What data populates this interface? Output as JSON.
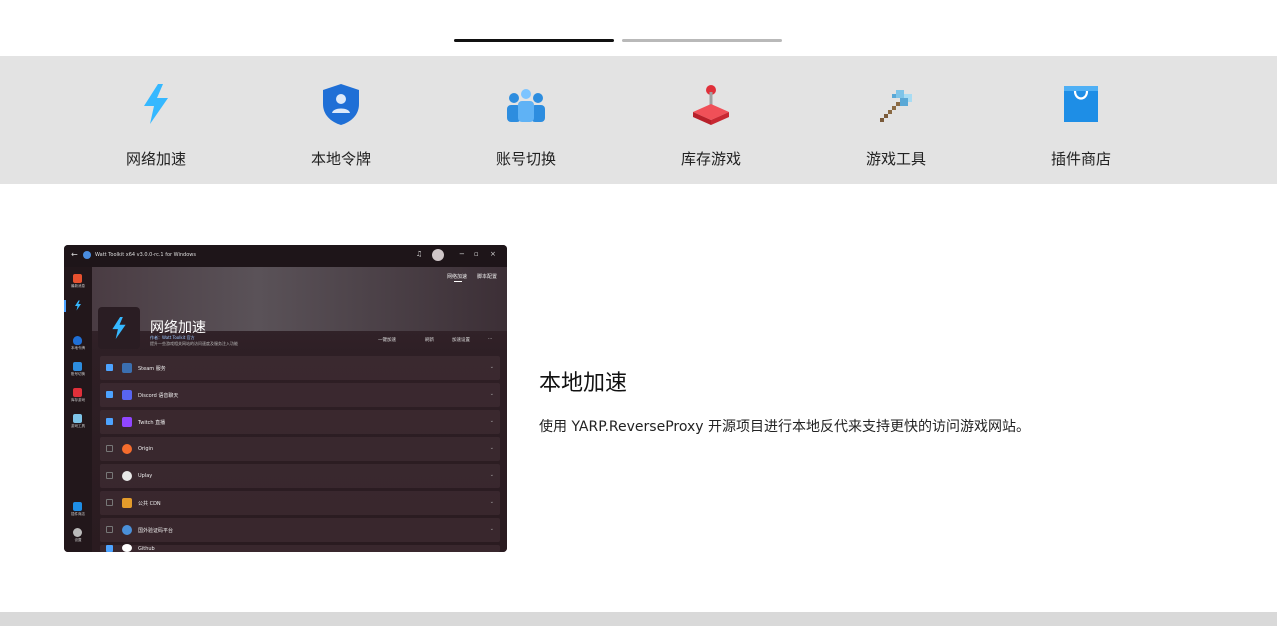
{
  "pager": {
    "active_index": 0,
    "count": 2
  },
  "features": [
    {
      "label": "网络加速",
      "icon": "lightning-icon",
      "color": "#35b8ff"
    },
    {
      "label": "本地令牌",
      "icon": "shield-user-icon",
      "color": "#1f6fd6"
    },
    {
      "label": "账号切换",
      "icon": "users-group-icon",
      "color": "#2d8ddf"
    },
    {
      "label": "库存游戏",
      "icon": "joystick-icon",
      "color": "#e0303a"
    },
    {
      "label": "游戏工具",
      "icon": "pixel-axe-icon",
      "color": "#7ec4e8"
    },
    {
      "label": "插件商店",
      "icon": "shopping-bag-icon",
      "color": "#1e8ee6"
    }
  ],
  "screenshot": {
    "window_title": "Watt Toolkit x64 v3.0.0-rc.1 for Windows",
    "tabs": [
      "网络加速",
      "脚本配置"
    ],
    "sidebar": [
      {
        "label": "最新消息",
        "icon": "home-icon",
        "color": "#e8512f"
      },
      {
        "label": "",
        "icon": "lightning-icon",
        "color": "#35b8ff"
      },
      {
        "label": "本地令牌",
        "icon": "shield-icon",
        "color": "#1f6fd6"
      },
      {
        "label": "账号切换",
        "icon": "users-icon",
        "color": "#2d8ddf"
      },
      {
        "label": "库存游戏",
        "icon": "joystick-icon",
        "color": "#e0303a"
      },
      {
        "label": "游戏工具",
        "icon": "axe-icon",
        "color": "#7ec4e8"
      },
      {
        "label": "插件商店",
        "icon": "bag-icon",
        "color": "#1e8ee6"
      },
      {
        "label": "设置",
        "icon": "gear-icon",
        "color": "#bbbbbb"
      }
    ],
    "header": {
      "title": "网络加速",
      "author": "作者：Watt Toolkit  官方",
      "subtitle": "提升一些游戏相关网站的访问速度及服务注入功能",
      "actions": [
        "一键加速",
        "刷新",
        "加速设置",
        "···"
      ]
    },
    "rows": [
      {
        "label": "Steam 服务",
        "checked": true,
        "icon": "steam-icon",
        "color": "#3b6fb0"
      },
      {
        "label": "Discord 语音聊天",
        "checked": true,
        "icon": "discord-icon",
        "color": "#5865f2"
      },
      {
        "label": "Twitch 直播",
        "checked": true,
        "icon": "twitch-icon",
        "color": "#9146ff"
      },
      {
        "label": "Origin",
        "checked": false,
        "icon": "origin-icon",
        "color": "#f56c2d"
      },
      {
        "label": "Uplay",
        "checked": false,
        "icon": "uplay-icon",
        "color": "#e8e8e8"
      },
      {
        "label": "公共 CDN",
        "checked": false,
        "icon": "cdn-icon",
        "color": "#e39b2b"
      },
      {
        "label": "国外验证码平台",
        "checked": false,
        "icon": "captcha-icon",
        "color": "#4a90d9"
      },
      {
        "label": "Github",
        "checked": true,
        "icon": "github-icon",
        "color": "#ffffff"
      }
    ]
  },
  "description": {
    "title": "本地加速",
    "text": "使用 YARP.ReverseProxy 开源项目进行本地反代来支持更快的访问游戏网站。"
  }
}
